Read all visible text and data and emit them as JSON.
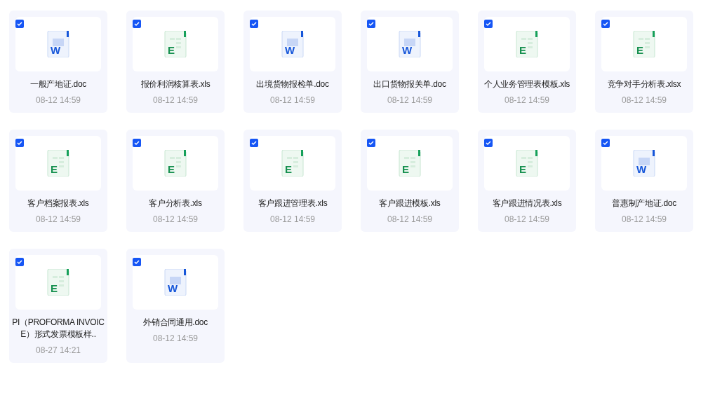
{
  "files": [
    {
      "kind": "word",
      "letter": "W",
      "name": "一般产地证.doc",
      "time": "08-12 14:59",
      "checked": true
    },
    {
      "kind": "excel",
      "letter": "E",
      "name": "报价利润核算表.xls",
      "time": "08-12 14:59",
      "checked": true
    },
    {
      "kind": "word",
      "letter": "W",
      "name": "出境货物报检单.doc",
      "time": "08-12 14:59",
      "checked": true
    },
    {
      "kind": "word",
      "letter": "W",
      "name": "出口货物报关单.doc",
      "time": "08-12 14:59",
      "checked": true
    },
    {
      "kind": "excel",
      "letter": "E",
      "name": "个人业务管理表模板.xls",
      "time": "08-12 14:59",
      "checked": true
    },
    {
      "kind": "excel",
      "letter": "E",
      "name": "竞争对手分析表.xlsx",
      "time": "08-12 14:59",
      "checked": true
    },
    {
      "kind": "excel",
      "letter": "E",
      "name": "客户档案报表.xls",
      "time": "08-12 14:59",
      "checked": true
    },
    {
      "kind": "excel",
      "letter": "E",
      "name": "客户分析表.xls",
      "time": "08-12 14:59",
      "checked": true
    },
    {
      "kind": "excel",
      "letter": "E",
      "name": "客户跟进管理表.xls",
      "time": "08-12 14:59",
      "checked": true
    },
    {
      "kind": "excel",
      "letter": "E",
      "name": "客户跟进模板.xls",
      "time": "08-12 14:59",
      "checked": true
    },
    {
      "kind": "excel",
      "letter": "E",
      "name": "客户跟进情况表.xls",
      "time": "08-12 14:59",
      "checked": true
    },
    {
      "kind": "word",
      "letter": "W",
      "name": "普惠制产地证.doc",
      "time": "08-12 14:59",
      "checked": true
    },
    {
      "kind": "excel",
      "letter": "E",
      "name": "PI（PROFORMA INVOICE）形式发票模板样..",
      "time": "08-27 14:21",
      "checked": true
    },
    {
      "kind": "word",
      "letter": "W",
      "name": "外销合同通用.doc",
      "time": "08-12 14:59",
      "checked": true
    }
  ]
}
